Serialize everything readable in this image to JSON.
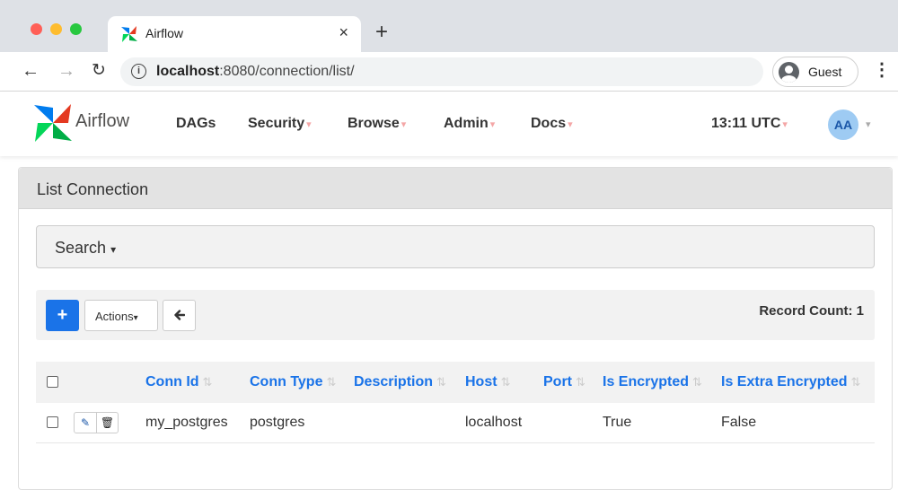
{
  "browser": {
    "tab_title": "Airflow",
    "tab_close": "×",
    "new_tab": "+",
    "url_host": "localhost",
    "url_rest": ":8080/connection/list/",
    "profile_label": "Guest",
    "traffic_light_colors": [
      "#ff5f57",
      "#febc2e",
      "#28c840"
    ]
  },
  "navbar": {
    "brand": "Airflow",
    "menu": [
      {
        "label": "DAGs",
        "has_caret": false
      },
      {
        "label": "Security",
        "has_caret": true
      },
      {
        "label": "Browse",
        "has_caret": true
      },
      {
        "label": "Admin",
        "has_caret": true
      },
      {
        "label": "Docs",
        "has_caret": true
      }
    ],
    "clock": "13:11 UTC",
    "user_initials": "AA",
    "caret_color": "#f4a6a6"
  },
  "panel": {
    "title": "List Connection",
    "search_label": "Search",
    "add_label": "+",
    "actions_label": "Actions",
    "back_label": "🡐",
    "record_count": "Record Count: 1"
  },
  "table": {
    "columns": [
      "Conn Id",
      "Conn Type",
      "Description",
      "Host",
      "Port",
      "Is Encrypted",
      "Is Extra Encrypted"
    ],
    "rows": [
      {
        "conn_id": "my_postgres",
        "conn_type": "postgres",
        "description": "",
        "host": "localhost",
        "port": "",
        "is_encrypted": "True",
        "is_extra_encrypted": "False"
      }
    ]
  },
  "colors": {
    "accent": "#1a73e8",
    "panel_header": "#e3e3e3",
    "well": "#f2f2f2"
  }
}
